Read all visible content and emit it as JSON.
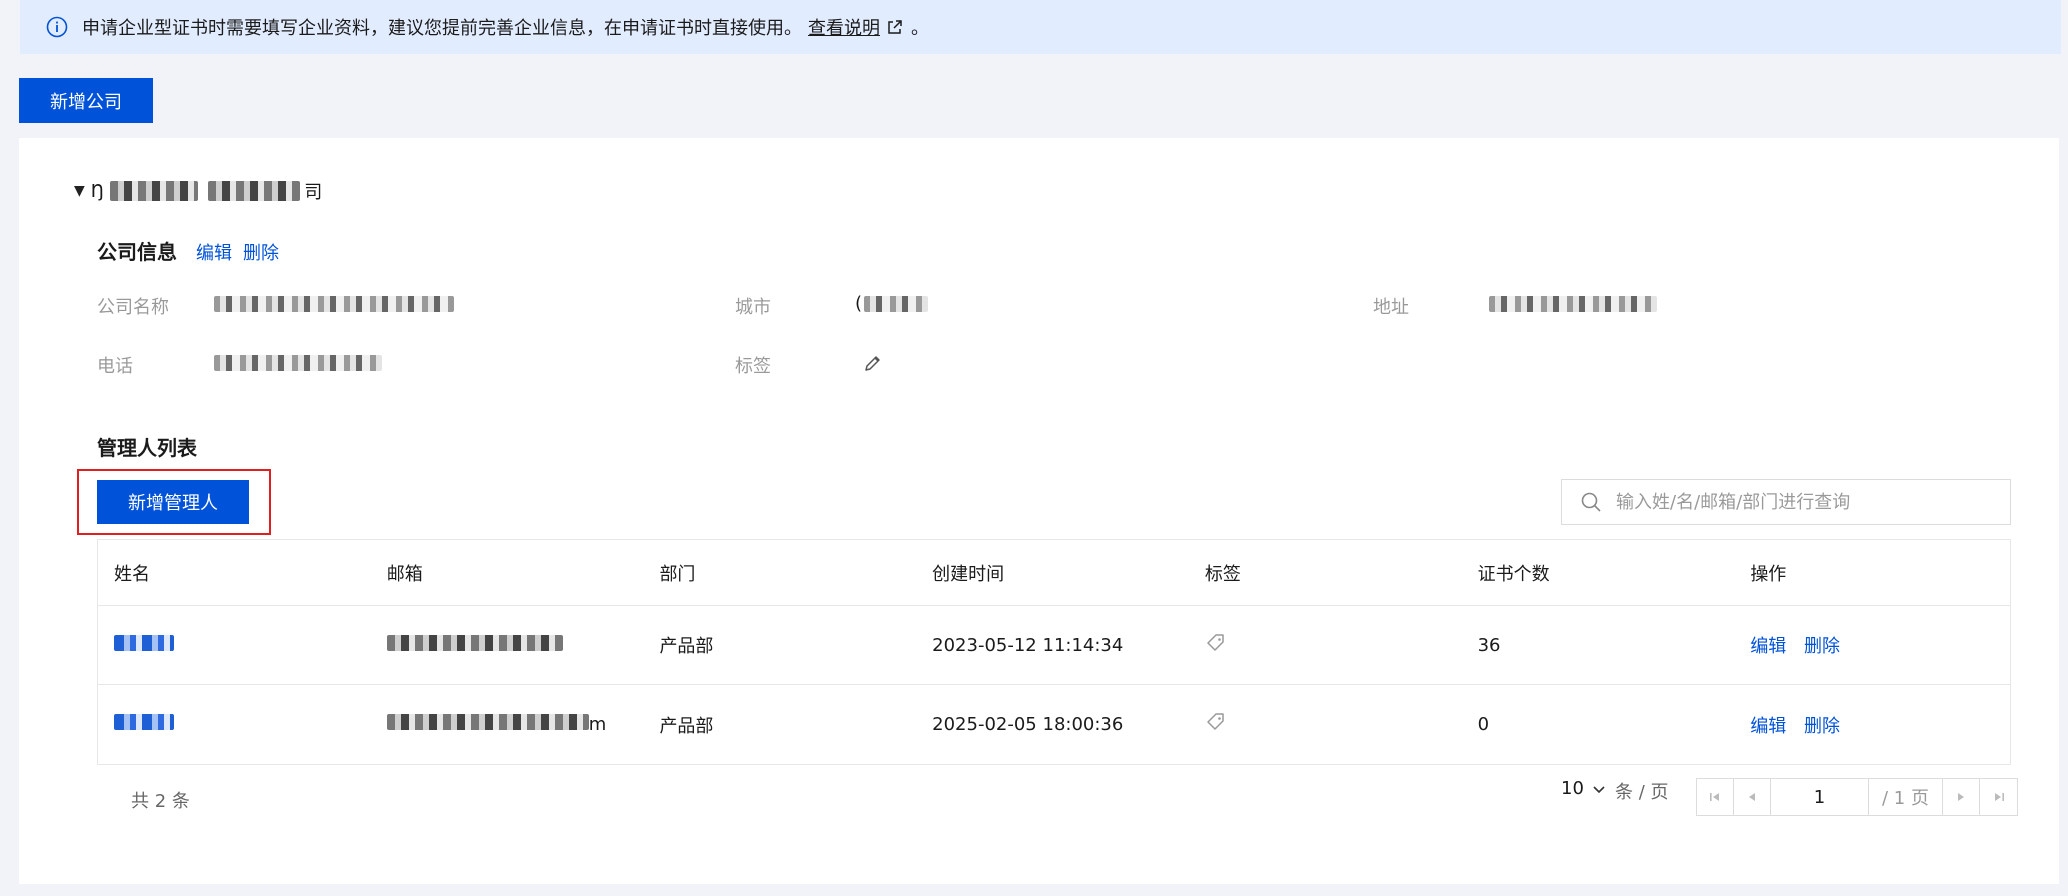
{
  "notice": {
    "text": "申请企业型证书时需要填写企业资料，建议您提前完善企业信息，在申请证书时直接使用。",
    "link_label": "查看说明",
    "tail": "。"
  },
  "toolbar": {
    "add_company_label": "新增公司"
  },
  "company": {
    "name_prefix": "Ŋ",
    "name_suffix": "司",
    "info_title": "公司信息",
    "edit_label": "编辑",
    "delete_label": "删除",
    "fields": {
      "name_label": "公司名称",
      "city_label": "城市",
      "city_prefix": "(",
      "address_label": "地址",
      "phone_label": "电话",
      "tags_label": "标签"
    }
  },
  "admins": {
    "title": "管理人列表",
    "add_label": "新增管理人",
    "search_placeholder": "输入姓/名/邮箱/部门进行查询",
    "columns": [
      "姓名",
      "邮箱",
      "部门",
      "创建时间",
      "标签",
      "证书个数",
      "操作"
    ],
    "rows": [
      {
        "department": "产品部",
        "created": "2023-05-12 11:14:34",
        "cert_count": "36",
        "edit": "编辑",
        "delete": "删除",
        "email_suffix": ""
      },
      {
        "department": "产品部",
        "created": "2025-02-05 18:00:36",
        "cert_count": "0",
        "edit": "编辑",
        "delete": "删除",
        "email_suffix": "m"
      }
    ],
    "total_label": "共 2 条"
  },
  "pagination": {
    "page_size": "10",
    "page_size_unit": "条 / 页",
    "current_page": "1",
    "total_pages": "/ 1 页"
  },
  "colors": {
    "primary": "#0052d9",
    "highlight_border": "#e02020",
    "notice_bg": "#e2ecff"
  }
}
